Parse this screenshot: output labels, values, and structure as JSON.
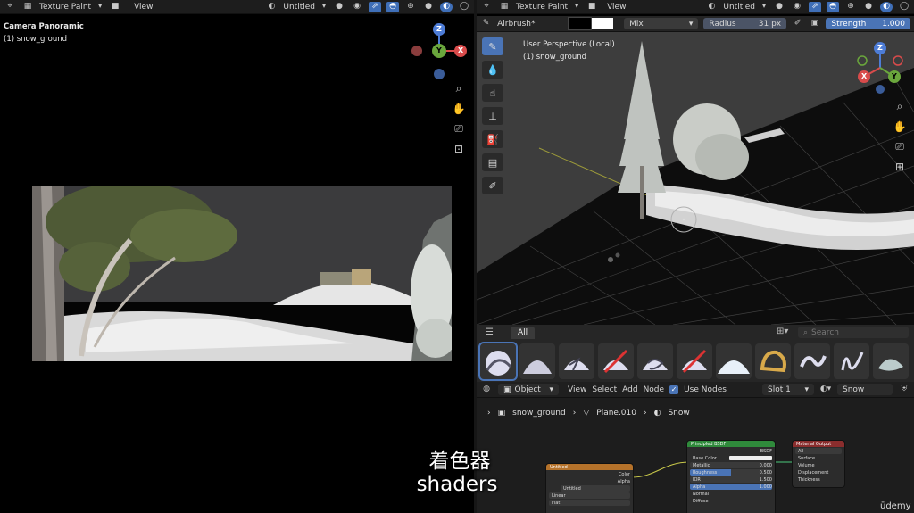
{
  "left_header": {
    "mode": "Texture Paint",
    "view": "View",
    "image_name": "Untitled"
  },
  "left_viewport": {
    "camera_label": "Camera Panoramic",
    "object_label": "(1) snow_ground",
    "gizmo_z": "Z",
    "gizmo_y": "Y",
    "gizmo_x": "X"
  },
  "right_header": {
    "mode": "Texture Paint",
    "view": "View",
    "image_name": "Untitled"
  },
  "brush_bar": {
    "brush_name": "Airbrush*",
    "blend_mode": "Mix",
    "radius_label": "Radius",
    "radius_value": "31 px",
    "strength_label": "Strength",
    "strength_value": "1.000"
  },
  "right_viewport": {
    "perspective_label": "User Perspective (Local)",
    "object_label": "(1) snow_ground",
    "gizmo_z": "Z",
    "gizmo_y": "Y",
    "gizmo_x": "X"
  },
  "asset_shelf": {
    "tab": "All",
    "search_placeholder": "Search"
  },
  "node_header": {
    "object_mode": "Object",
    "view": "View",
    "select": "Select",
    "add": "Add",
    "node": "Node",
    "use_nodes_label": "Use Nodes",
    "slot": "Slot 1",
    "material": "Snow"
  },
  "breadcrumb": {
    "object": "snow_ground",
    "mesh": "Plane.010",
    "material": "Snow"
  },
  "nodes": {
    "image_node_title": "Untitled",
    "image_color": "Color",
    "image_alpha": "Alpha",
    "image_name_field": "Untitled",
    "image_interp": "Linear",
    "image_proj": "Flat",
    "bsdf_title": "Principled BSDF",
    "bsdf_out": "BSDF",
    "bsdf_base_color": "Base Color",
    "bsdf_metallic": "Metallic",
    "bsdf_metallic_value": "0.000",
    "bsdf_roughness": "Roughness",
    "bsdf_roughness_value": "0.500",
    "bsdf_ior": "IOR",
    "bsdf_ior_value": "1.500",
    "bsdf_alpha": "Alpha",
    "bsdf_alpha_value": "1.000",
    "bsdf_normal": "Normal",
    "bsdf_diffuse": "Diffuse",
    "output_title": "Material Output",
    "output_target": "All",
    "output_surface": "Surface",
    "output_volume": "Volume",
    "output_displacement": "Displacement",
    "output_thickness": "Thickness"
  },
  "subtitle": {
    "zh": "着色器",
    "en": "shaders"
  },
  "watermark": "ūdemy",
  "colors": {
    "accent": "#4a74b6",
    "header_bg": "#1d1d1d",
    "bsdf_header": "#2f8a3b",
    "output_header": "#8a2d2d",
    "image_header": "#b5722a"
  }
}
